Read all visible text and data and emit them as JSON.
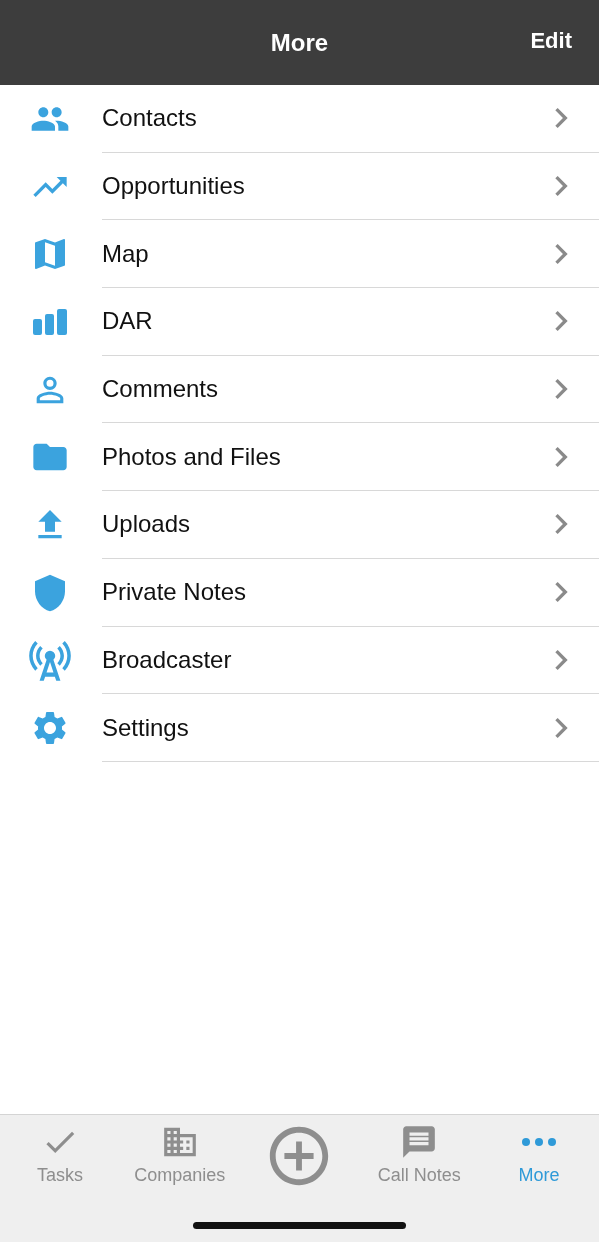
{
  "header": {
    "title": "More",
    "action": "Edit"
  },
  "items": [
    {
      "label": "Contacts"
    },
    {
      "label": "Opportunities"
    },
    {
      "label": "Map"
    },
    {
      "label": "DAR"
    },
    {
      "label": "Comments"
    },
    {
      "label": "Photos and Files"
    },
    {
      "label": "Uploads"
    },
    {
      "label": "Private Notes"
    },
    {
      "label": "Broadcaster"
    },
    {
      "label": "Settings"
    }
  ],
  "tab_bar": [
    {
      "kind": "tab",
      "label": "Tasks",
      "selected": false
    },
    {
      "kind": "tab",
      "label": "Companies",
      "selected": false
    },
    {
      "kind": "add",
      "selected": false
    },
    {
      "kind": "tab",
      "label": "Call Notes",
      "selected": false
    },
    {
      "kind": "tab",
      "label": "More",
      "selected": true
    }
  ]
}
